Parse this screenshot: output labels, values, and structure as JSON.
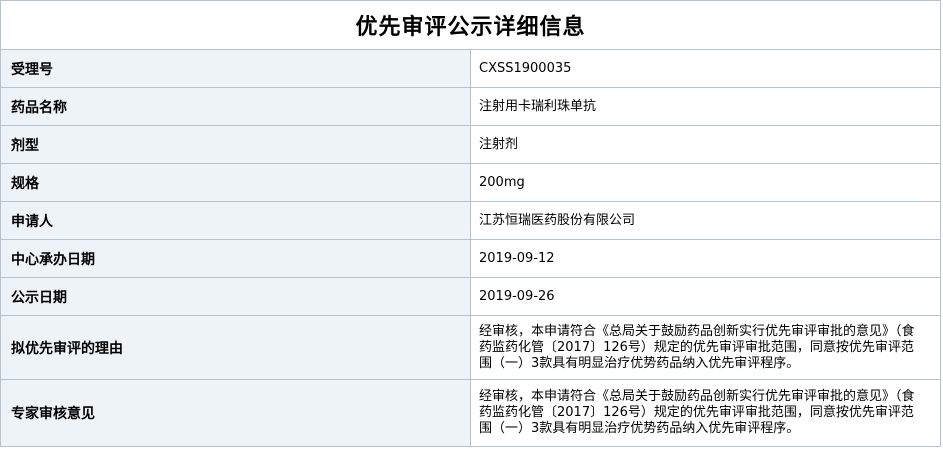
{
  "title": "优先审评公示详细信息",
  "rows": [
    {
      "label": "受理号",
      "value": "CXSS1900035"
    },
    {
      "label": "药品名称",
      "value": "注射用卡瑞利珠单抗"
    },
    {
      "label": "剂型",
      "value": "注射剂"
    },
    {
      "label": "规格",
      "value": "200mg"
    },
    {
      "label": "申请人",
      "value": "江苏恒瑞医药股份有限公司"
    },
    {
      "label": "中心承办日期",
      "value": "2019-09-12"
    },
    {
      "label": "公示日期",
      "value": "2019-09-26"
    },
    {
      "label": "拟优先审评的理由",
      "value": "经审核，本申请符合《总局关于鼓励药品创新实行优先审评审批的意见》（食药监药化管〔2017〕126号）规定的优先审评审批范围，同意按优先审评范围（一）3款具有明显治疗优势药品纳入优先审评程序。"
    },
    {
      "label": "专家审核意见",
      "value": "经审核，本申请符合《总局关于鼓励药品创新实行优先审评审批的意见》（食药监药化管〔2017〕126号）规定的优先审评审批范围，同意按优先审评范围（一）3款具有明显治疗优势药品纳入优先审评程序。"
    }
  ]
}
